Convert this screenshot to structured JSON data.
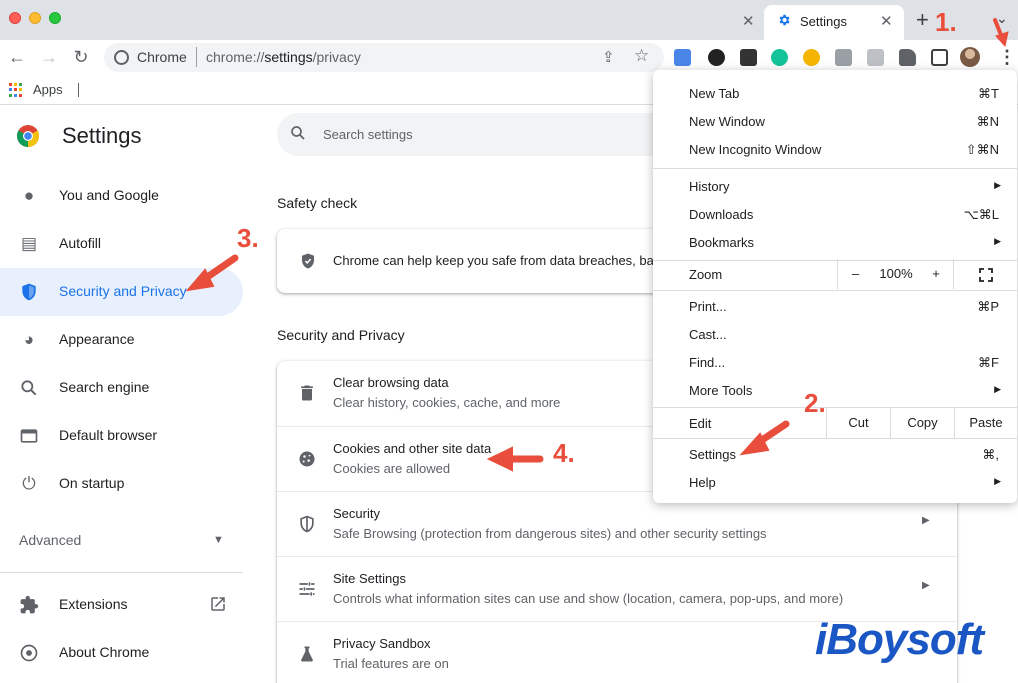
{
  "browser": {
    "tab": {
      "title": "Settings"
    },
    "omnibox": {
      "scheme_label": "Chrome",
      "url_prefix": "chrome://",
      "url_host": "settings",
      "url_path": "/privacy"
    },
    "bookmarks": {
      "apps_label": "Apps"
    }
  },
  "settings": {
    "title": "Settings",
    "search_placeholder": "Search settings",
    "nav": [
      {
        "label": "You and Google",
        "icon": "person-icon"
      },
      {
        "label": "Autofill",
        "icon": "clipboard-icon"
      },
      {
        "label": "Security and Privacy",
        "icon": "shield-icon",
        "selected": true
      },
      {
        "label": "Appearance",
        "icon": "palette-icon"
      },
      {
        "label": "Search engine",
        "icon": "search-icon"
      },
      {
        "label": "Default browser",
        "icon": "browser-window-icon"
      },
      {
        "label": "On startup",
        "icon": "power-icon"
      }
    ],
    "advanced_label": "Advanced",
    "extensions_label": "Extensions",
    "about_label": "About Chrome",
    "safety_check": {
      "heading": "Safety check",
      "text": "Chrome can help keep you safe from data breaches, bad"
    },
    "privacy": {
      "heading": "Security and Privacy",
      "rows": [
        {
          "title": "Clear browsing data",
          "subtitle": "Clear history, cookies, cache, and more"
        },
        {
          "title": "Cookies and other site data",
          "subtitle": "Cookies are allowed"
        },
        {
          "title": "Security",
          "subtitle": "Safe Browsing (protection from dangerous sites) and other security settings"
        },
        {
          "title": "Site Settings",
          "subtitle": "Controls what information sites can use and show (location, camera, pop-ups, and more)"
        },
        {
          "title": "Privacy Sandbox",
          "subtitle": "Trial features are on"
        }
      ]
    }
  },
  "menu": {
    "items": [
      {
        "label": "New Tab",
        "shortcut": "⌘T"
      },
      {
        "label": "New Window",
        "shortcut": "⌘N"
      },
      {
        "label": "New Incognito Window",
        "shortcut": "⇧⌘N"
      },
      {
        "label": "History",
        "submenu": true
      },
      {
        "label": "Downloads",
        "shortcut": "⌥⌘L"
      },
      {
        "label": "Bookmarks",
        "submenu": true
      },
      {
        "label": "Print...",
        "shortcut": "⌘P"
      },
      {
        "label": "Cast..."
      },
      {
        "label": "Find...",
        "shortcut": "⌘F"
      },
      {
        "label": "More Tools",
        "submenu": true
      },
      {
        "label": "Settings",
        "shortcut": "⌘,"
      },
      {
        "label": "Help",
        "submenu": true
      }
    ],
    "zoom": {
      "label": "Zoom",
      "minus": "–",
      "value": "100%",
      "plus": "+"
    },
    "edit": {
      "label": "Edit",
      "cut": "Cut",
      "copy": "Copy",
      "paste": "Paste"
    }
  },
  "annotations": {
    "step1": "1.",
    "step2": "2.",
    "step3": "3.",
    "step4": "4.",
    "watermark": "iBoysoft"
  },
  "colors": {
    "accent": "#1a73e8",
    "selected_bg": "#e8f0fe",
    "annotation": "#e94e3c",
    "watermark": "#1a56c4"
  }
}
